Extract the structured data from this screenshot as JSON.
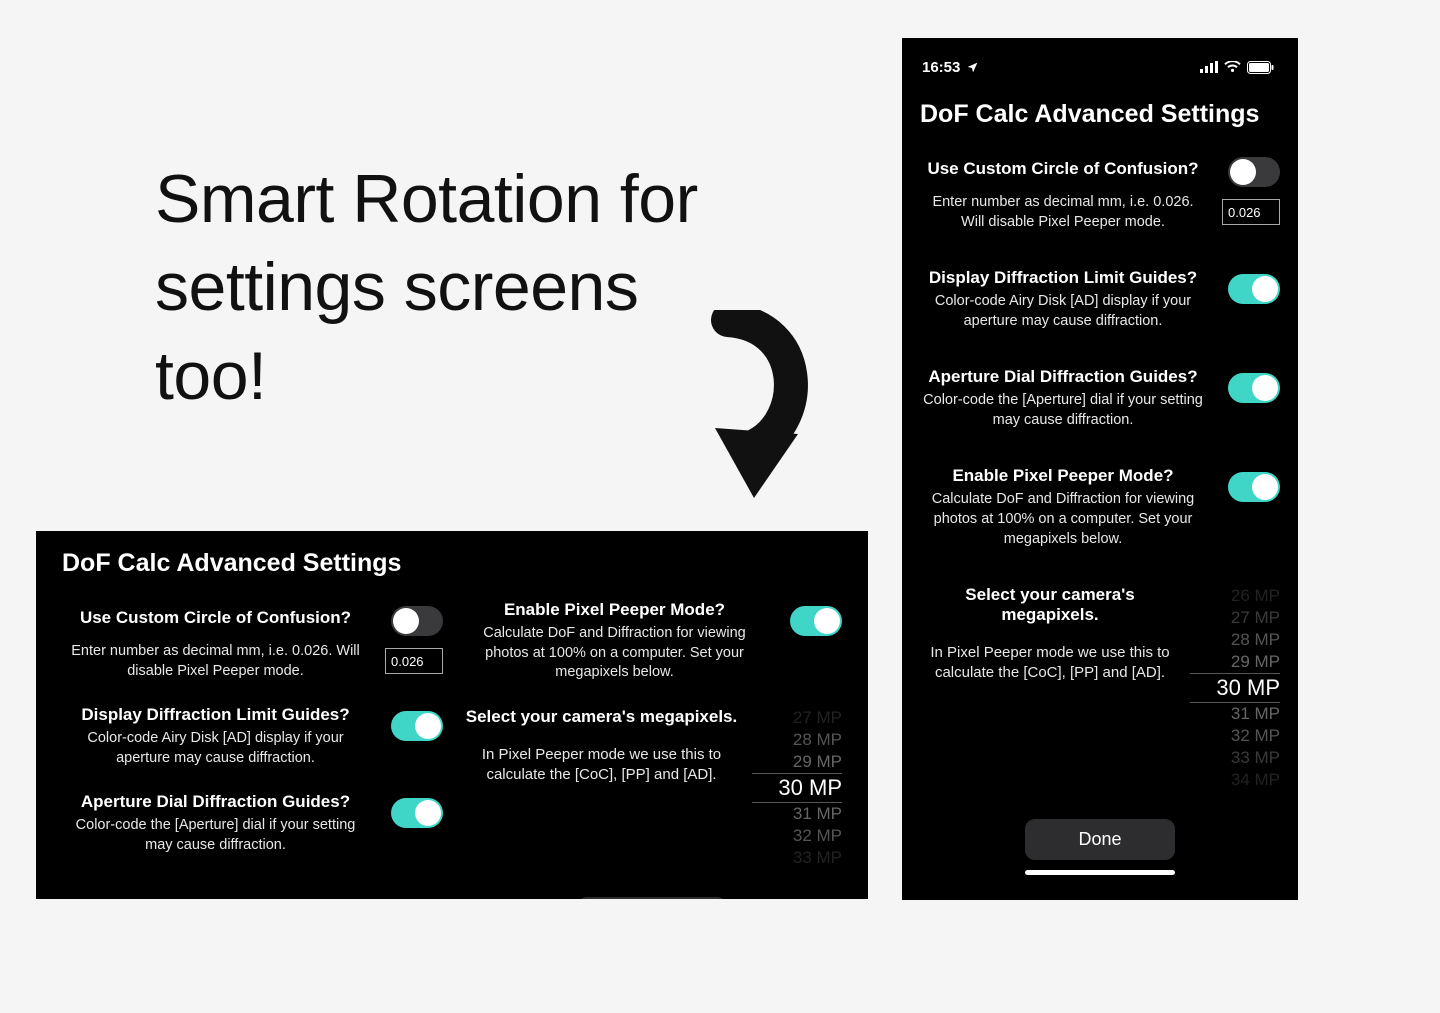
{
  "headline": "Smart Rotation for settings screens too!",
  "screen_title": "DoF Calc Advanced Settings",
  "done_label": "Done",
  "status": {
    "time": "16:53",
    "location_icon": "location-arrow-icon",
    "signal_icon": "cellular-signal-icon",
    "wifi_icon": "wifi-icon",
    "battery_icon": "battery-icon"
  },
  "settings": {
    "coc": {
      "label": "Use Custom Circle of Confusion?",
      "desc": "Enter number as decimal mm, i.e. 0.026. Will disable Pixel Peeper mode.",
      "toggle": false,
      "value": "0.026"
    },
    "diffraction_guides": {
      "label": "Display Diffraction Limit Guides?",
      "desc": "Color-code Airy Disk [AD] display if your aperture may cause diffraction.",
      "toggle": true
    },
    "aperture_guides": {
      "label": "Aperture Dial Diffraction Guides?",
      "desc": "Color-code the [Aperture] dial if your setting may cause diffraction.",
      "toggle": true
    },
    "pixel_peeper": {
      "label": "Enable Pixel Peeper Mode?",
      "desc": "Calculate DoF and Diffraction for viewing photos at 100% on a computer. Set your megapixels below.",
      "toggle": true
    },
    "megapixels": {
      "label": "Select your camera's megapixels.",
      "desc": "In Pixel Peeper mode we use this to calculate the [CoC], [PP] and [AD].",
      "options": [
        "26 MP",
        "27 MP",
        "28 MP",
        "29 MP",
        "30 MP",
        "31 MP",
        "32 MP",
        "33 MP",
        "34 MP"
      ],
      "selected": "30 MP"
    }
  }
}
